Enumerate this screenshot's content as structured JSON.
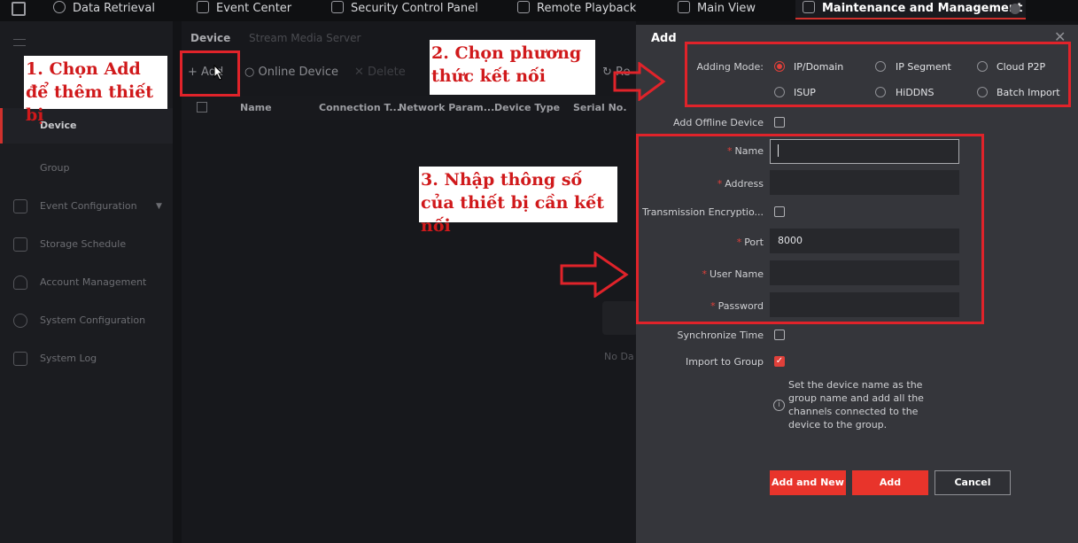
{
  "topbar": {
    "tabs": [
      {
        "label": "Data Retrieval",
        "icon": "data-retrieval-icon"
      },
      {
        "label": "Event Center",
        "icon": "alarm-icon"
      },
      {
        "label": "Security Control Panel",
        "icon": "alarm-icon"
      },
      {
        "label": "Remote Playback",
        "icon": "playback-icon"
      },
      {
        "label": "Main View",
        "icon": "camera-icon"
      },
      {
        "label": "Maintenance and Management",
        "icon": "maintenance-icon",
        "active": true
      }
    ]
  },
  "sidebar": {
    "items": [
      {
        "label": "Device",
        "active": true
      },
      {
        "label": "Group"
      },
      {
        "label": "Event Configuration",
        "icon": "event-config-icon"
      },
      {
        "label": "Storage Schedule",
        "icon": "storage-icon"
      },
      {
        "label": "Account Management",
        "icon": "user-icon"
      },
      {
        "label": "System Configuration",
        "icon": "gear-icon"
      },
      {
        "label": "System Log",
        "icon": "log-icon"
      }
    ]
  },
  "main": {
    "tabs": [
      "Device",
      "Stream Media Server"
    ],
    "toolbar": {
      "add": "Add",
      "online": "Online Device",
      "delete": "Delete",
      "refresh": "Re"
    },
    "columns": [
      "Name",
      "Connection T...",
      "Network Param...",
      "Device Type",
      "Serial No."
    ],
    "empty": "No Da"
  },
  "dialog": {
    "title": "Add",
    "adding_mode_label": "Adding Mode:",
    "modes": [
      "IP/Domain",
      "IP Segment",
      "Cloud P2P",
      "ISUP",
      "HiDDNS",
      "Batch Import"
    ],
    "selected_mode": "IP/Domain",
    "add_offline": "Add Offline Device",
    "fields": {
      "name": "Name",
      "address": "Address",
      "encryption": "Transmission Encryptio...",
      "port": "Port",
      "port_value": "8000",
      "username": "User Name",
      "password": "Password"
    },
    "sync_time": "Synchronize Time",
    "import_group": "Import to Group",
    "import_group_checked": true,
    "info": "Set the device name as the group name and add all the channels connected to the device to the group.",
    "buttons": {
      "add_new": "Add and New",
      "add": "Add",
      "cancel": "Cancel"
    }
  },
  "annotations": {
    "step1": "1. Chọn Add để thêm thiết bị",
    "step2": "2. Chọn phương thức kết nối",
    "step3": "3. Nhập thông số của thiết bị cần kết nối"
  },
  "colors": {
    "accent": "#e8342b",
    "annotation": "#e0232a"
  }
}
